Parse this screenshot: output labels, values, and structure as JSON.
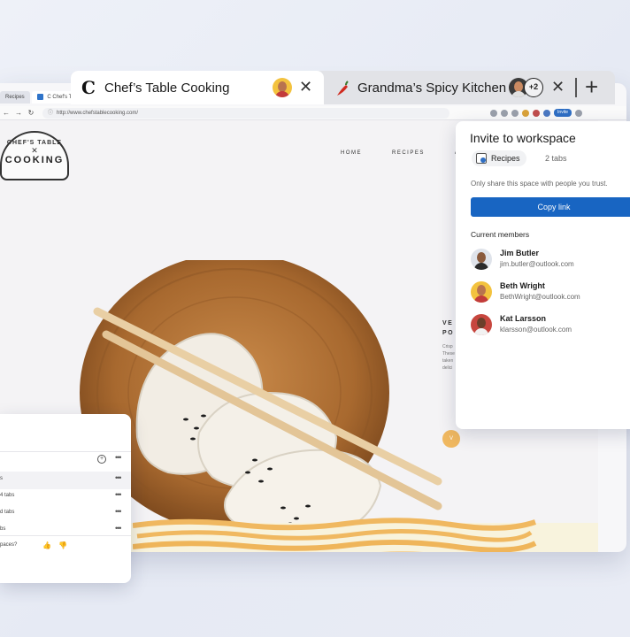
{
  "colors": {
    "accent": "#1865c2",
    "tab_strip": "#e2e3e7",
    "cream_band": "#f8f3dd",
    "noodle_orange": "#f0b860"
  },
  "back_window": {
    "mini_tabs": [
      {
        "label": "Recipes"
      },
      {
        "label": "C Chef's Ta"
      }
    ],
    "address": "http://www.chefstablecooking.com/",
    "invite_pill": "Invite",
    "site": {
      "logo_top": "CHEF'S TABLE",
      "logo_main": "COOKING",
      "nav": [
        "HOME",
        "RECIPES",
        "A"
      ],
      "hero_title": [
        "VE",
        "PO"
      ],
      "hero_body": [
        "Crisp",
        "These",
        "taken",
        "delici"
      ],
      "hero_button": "V"
    }
  },
  "tabs": [
    {
      "favicon": "C",
      "title": "Chef’s Table Cooking",
      "icon": "chef-c-icon"
    },
    {
      "title": "Grandma’s Spicy Kitchen",
      "icon": "chili-pepper-icon",
      "extra_members": "+2"
    }
  ],
  "invite_panel": {
    "title": "Invite to workspace",
    "workspace_name": "Recipes",
    "tab_count": "2 tabs",
    "notice": "Only share this space with people you trust.",
    "copy_button": "Copy link",
    "members_heading": "Current members",
    "members": [
      {
        "name": "Jim Butler",
        "email": "jim.butler@outlook.com"
      },
      {
        "name": "Beth Wright",
        "email": "BethWright@outlook.com"
      },
      {
        "name": "Kat Larsson",
        "email": "klarsson@outlook.com"
      }
    ]
  },
  "workspaces_panel": {
    "rows": [
      {
        "label": "s"
      },
      {
        "label": "4 tabs"
      },
      {
        "label": "d tabs"
      },
      {
        "label": "bs"
      }
    ],
    "feedback": "paces?"
  }
}
